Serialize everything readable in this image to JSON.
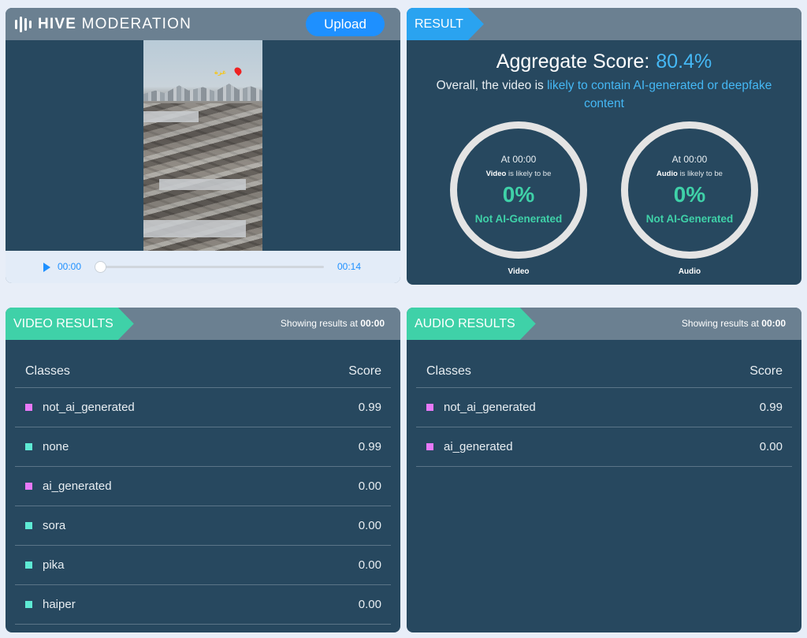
{
  "header": {
    "brand_bold": "HIVE",
    "brand_light": "MODERATION",
    "upload_label": "Upload"
  },
  "player": {
    "current_time": "00:00",
    "duration": "00:14",
    "progress": 0,
    "overlay_label": "غزة"
  },
  "result": {
    "tab_label": "RESULT",
    "aggregate_label": "Aggregate Score:",
    "aggregate_value": "80.4%",
    "overall_prefix": "Overall, the video is",
    "overall_highlight": "likely to contain AI-generated or deepfake content",
    "gauges": [
      {
        "at": "At 00:00",
        "subject": "Video",
        "likely": " is likely to be",
        "percent": "0%",
        "verdict": "Not AI-Generated",
        "caption": "Video"
      },
      {
        "at": "At 00:00",
        "subject": "Audio",
        "likely": " is likely to be",
        "percent": "0%",
        "verdict": "Not AI-Generated",
        "caption": "Audio"
      }
    ]
  },
  "video_results": {
    "tab_label": "VIDEO RESULTS",
    "showing_prefix": "Showing results at",
    "showing_time": "00:00",
    "col_classes": "Classes",
    "col_score": "Score",
    "rows": [
      {
        "name": "not_ai_generated",
        "score": "0.99",
        "color": "#e879f9"
      },
      {
        "name": "none",
        "score": "0.99",
        "color": "#5eead4"
      },
      {
        "name": "ai_generated",
        "score": "0.00",
        "color": "#e879f9"
      },
      {
        "name": "sora",
        "score": "0.00",
        "color": "#5eead4"
      },
      {
        "name": "pika",
        "score": "0.00",
        "color": "#5eead4"
      },
      {
        "name": "haiper",
        "score": "0.00",
        "color": "#5eead4"
      }
    ]
  },
  "audio_results": {
    "tab_label": "AUDIO RESULTS",
    "showing_prefix": "Showing results at",
    "showing_time": "00:00",
    "col_classes": "Classes",
    "col_score": "Score",
    "rows": [
      {
        "name": "not_ai_generated",
        "score": "0.99",
        "color": "#e879f9"
      },
      {
        "name": "ai_generated",
        "score": "0.00",
        "color": "#e879f9"
      }
    ]
  },
  "colors": {
    "accent_blue": "#1e90ff",
    "accent_green": "#3fd1a8",
    "panel": "#27485f"
  }
}
